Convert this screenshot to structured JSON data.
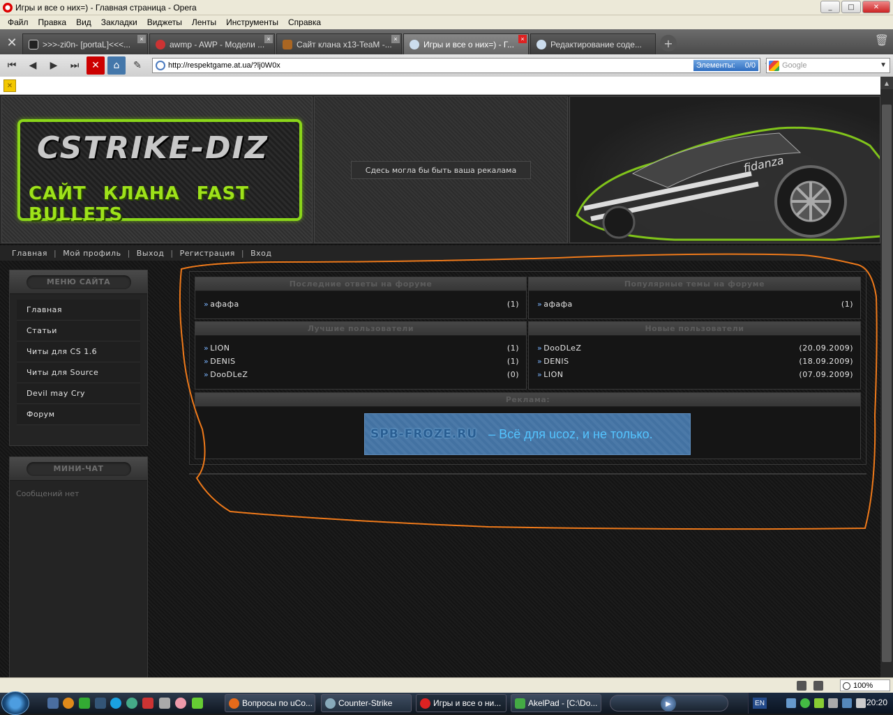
{
  "window": {
    "title": "Игры и все о них=) - Главная страница - Opera",
    "minimize": "_",
    "maximize": "□",
    "close": "✕"
  },
  "menu": [
    "Файл",
    "Правка",
    "Вид",
    "Закладки",
    "Виджеты",
    "Ленты",
    "Инструменты",
    "Справка"
  ],
  "tabs": [
    {
      "label": ">>>-zi0n- [portaL]<<<...",
      "icon": "counter-strike-icon"
    },
    {
      "label": "awmp - AWP - Модели ...",
      "icon": "lastfm-icon"
    },
    {
      "label": "Сайт клана x13-TeaM -...",
      "icon": "clan-site-icon"
    },
    {
      "label": "Игры и все о них=) - Г...",
      "icon": "ucoz-icon",
      "active": true
    },
    {
      "label": "Редактирование соде...",
      "icon": "ucoz-icon"
    }
  ],
  "address": {
    "url": "http://respektgame.at.ua/?lj0W0x",
    "elements_label": "Элементы:",
    "elements_value": "0/0",
    "search_placeholder": "Google"
  },
  "header": {
    "logo_title": "CSTRIKE-DIZ",
    "logo_sub": "САЙТ КЛАНА FAST BULLETS",
    "ad_text": "Сдесь могла бы быть ваша рекалама"
  },
  "topnav": [
    "Главная",
    "Мой профиль",
    "Выход",
    "Регистрация",
    "Вход"
  ],
  "sidebar": {
    "menu_title": "МЕНЮ САЙТА",
    "items": [
      "Главная",
      "Статьи",
      "Читы для CS 1.6",
      "Читы для Source",
      "Devil may Cry",
      "Форум"
    ],
    "chat_title": "МИНИ-ЧАТ",
    "chat_empty": "Сообщений нет"
  },
  "blocks": {
    "forum_replies": {
      "title": "Последние ответы на форуме",
      "rows": [
        {
          "name": "афафа",
          "value": "(1)"
        }
      ]
    },
    "popular_topics": {
      "title": "Популярные темы на форуме",
      "rows": [
        {
          "name": "афафа",
          "value": "(1)"
        }
      ]
    },
    "best_users": {
      "title": "Лучшие пользователи",
      "rows": [
        {
          "name": "LION",
          "value": "(1)"
        },
        {
          "name": "DENIS",
          "value": "(1)"
        },
        {
          "name": "DooDLeZ",
          "value": "(0)"
        }
      ]
    },
    "new_users": {
      "title": "Новые пользователи",
      "rows": [
        {
          "name": "DooDLeZ",
          "value": "(20.09.2009)"
        },
        {
          "name": "DENIS",
          "value": "(18.09.2009)"
        },
        {
          "name": "LION",
          "value": "(07.09.2009)"
        }
      ]
    },
    "ads": {
      "title": "Реклама:",
      "banner_domain": "SPB-FROZE.RU",
      "banner_text": "–  Всё для ucoz, и не только."
    }
  },
  "statusbar": {
    "zoom": "100%"
  },
  "taskbar": {
    "tasks": [
      {
        "label": "Вопросы по uCo...",
        "icon": "firefox-icon"
      },
      {
        "label": "Counter-Strike",
        "icon": "steam-icon"
      },
      {
        "label": "Игры и все о ни...",
        "icon": "opera-icon",
        "active": true
      },
      {
        "label": "AkelPad - [C:\\Do...",
        "icon": "akelpad-icon"
      }
    ],
    "language": "EN",
    "clock": "20:20"
  },
  "colors": {
    "accent_green": "#8bd61a",
    "annotation_orange": "#f07a1a",
    "link_blue": "#7ab4ff"
  }
}
